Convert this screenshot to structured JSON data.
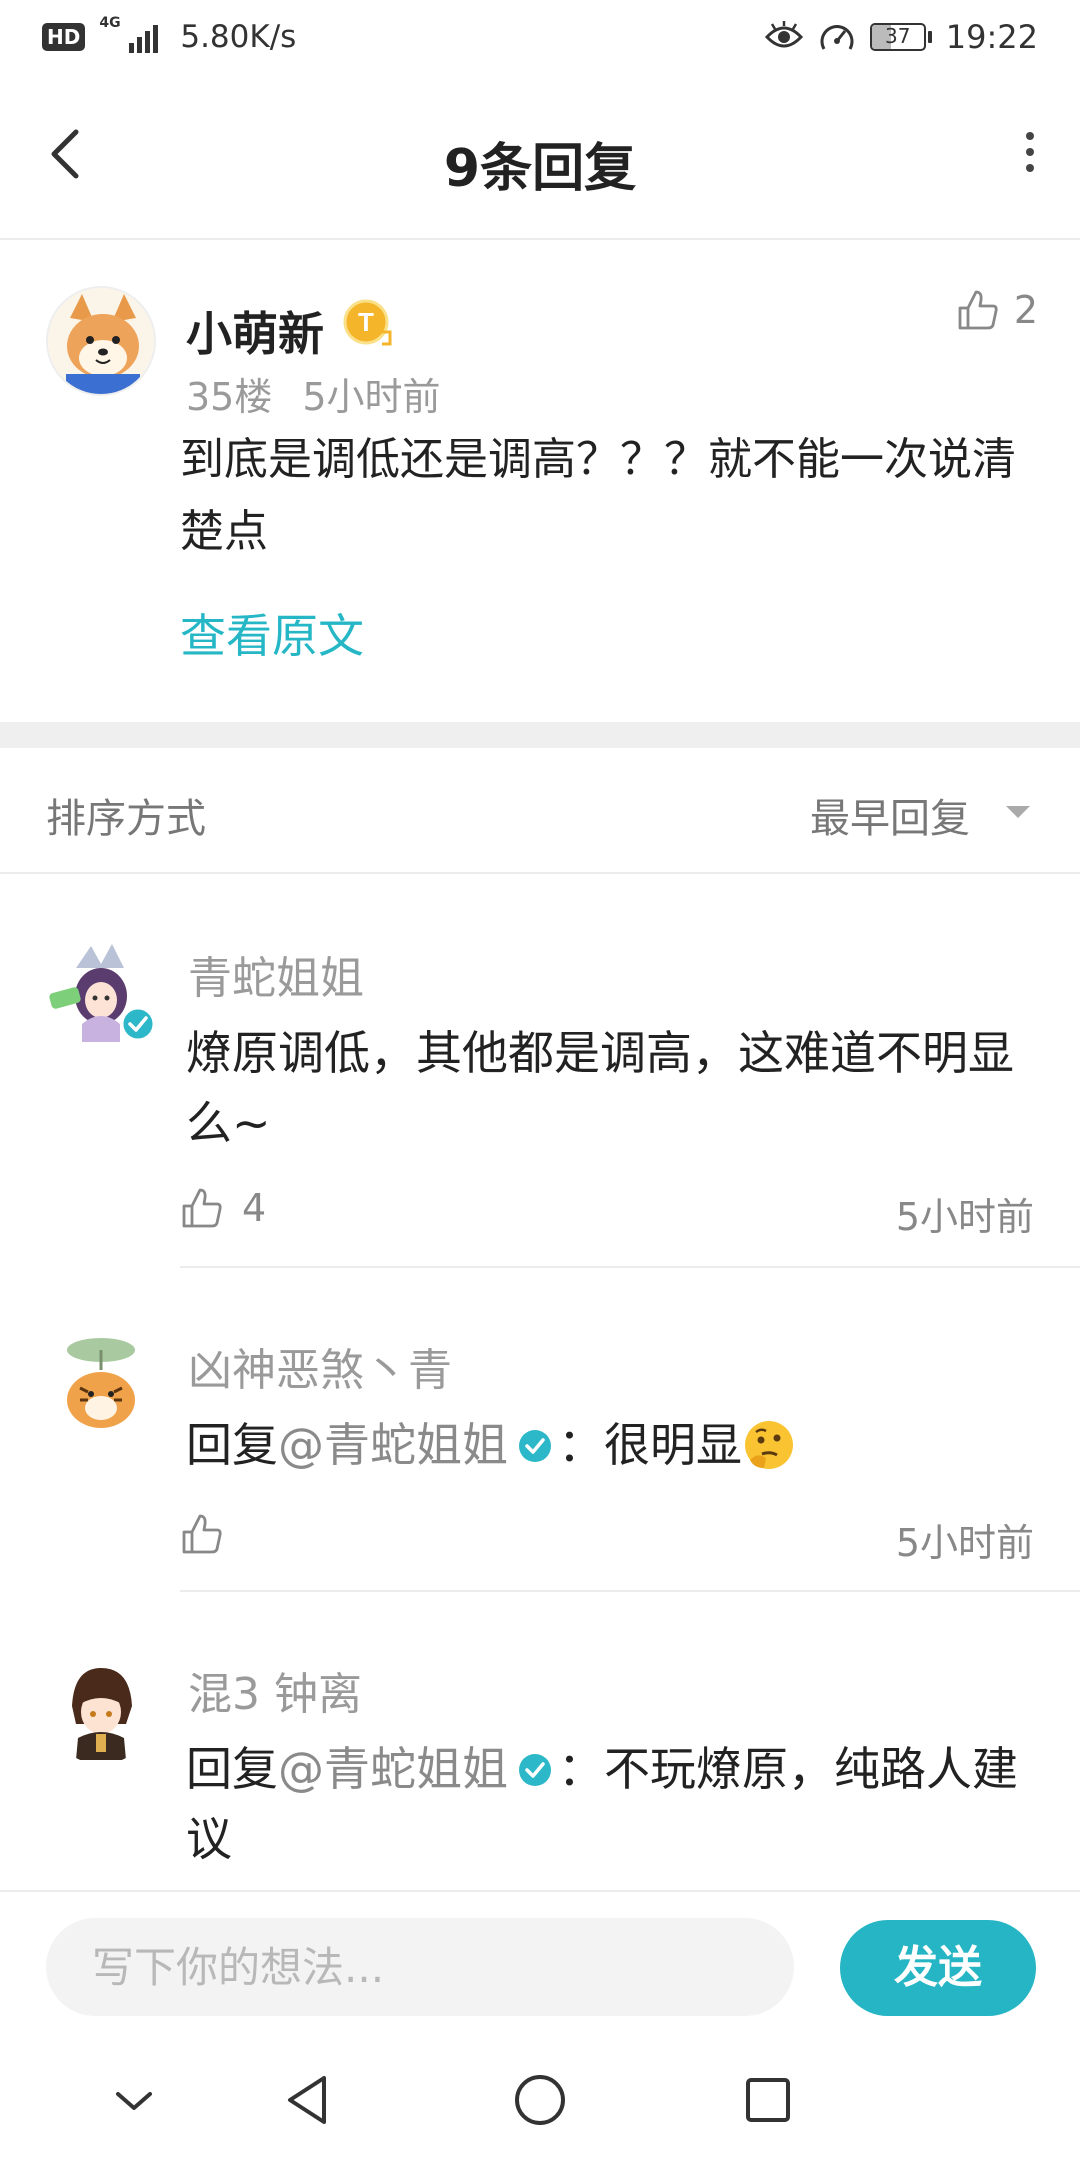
{
  "status_bar": {
    "hd": "HD",
    "network": "4G",
    "speed": "5.80K/s",
    "battery": "37",
    "battery_level": 0.37,
    "time": "19:22"
  },
  "header": {
    "title": "9条回复"
  },
  "main_post": {
    "author": "小萌新",
    "badge": "T",
    "likes": "2",
    "floor": "35楼",
    "time": "5小时前",
    "text": "到底是调低还是调高？？？就不能一次说清楚点",
    "view_original": "查看原文"
  },
  "sort": {
    "label": "排序方式",
    "value": "最早回复"
  },
  "replies": [
    {
      "author": "青蛇姐姐",
      "text": "燎原调低，其他都是调高，这难道不明显么~",
      "likes": "4",
      "time": "5小时前"
    },
    {
      "author": "凶神恶煞丶青",
      "prefix": "回复",
      "mention": "@青蛇姐姐",
      "text": "：很明显",
      "emoji": "thinking-face",
      "likes": "",
      "time": "5小时前"
    },
    {
      "author": "混3 钟离",
      "prefix": "回复",
      "mention": "@青蛇姐姐",
      "text": "：不玩燎原，纯路人建 议"
    }
  ],
  "input": {
    "placeholder": "写下你的想法...",
    "send_label": "发送"
  },
  "colors": {
    "accent": "#26b7c6",
    "text": "#222222",
    "muted": "#9a9a9a"
  },
  "nav_icons": [
    "chevron-down-icon",
    "back-triangle-icon",
    "home-circle-icon",
    "recents-square-icon"
  ]
}
